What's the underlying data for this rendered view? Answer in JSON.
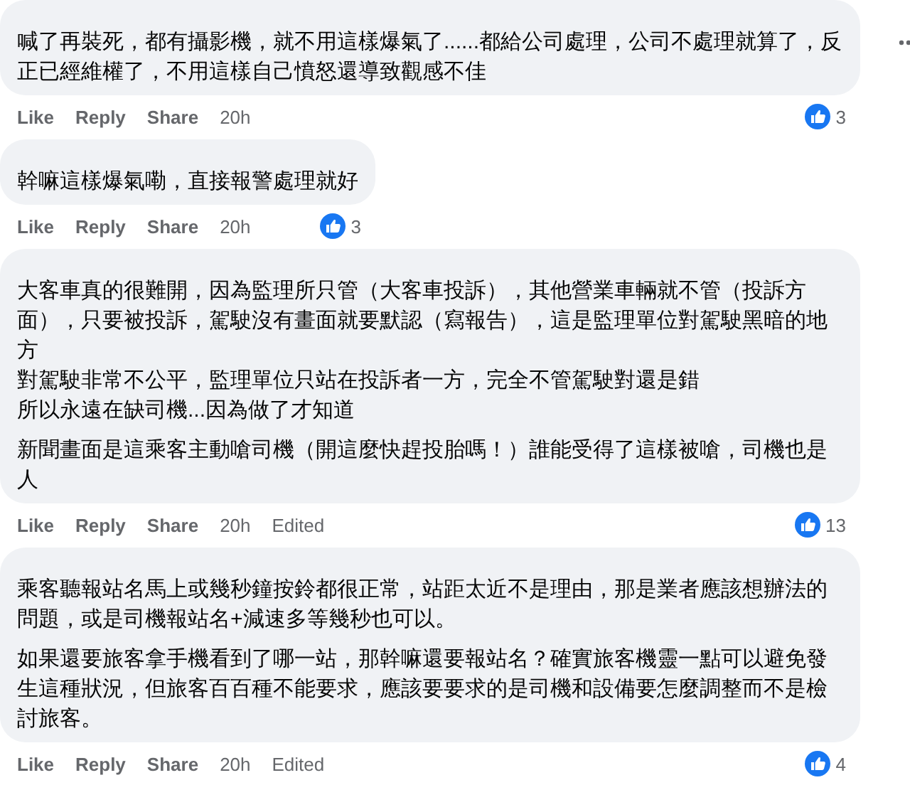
{
  "comments": [
    {
      "paragraphs": [
        "喊了再裝死，都有攝影機，就不用這樣爆氣了......都給公司處理，公司不處理就算了，反正已經維權了，不用這樣自己憤怒還導致觀感不佳"
      ],
      "actions": [
        "Like",
        "Reply",
        "Share"
      ],
      "time": "20h",
      "reactions": "3"
    },
    {
      "paragraphs": [
        "幹嘛這樣爆氣嘞，直接報警處理就好"
      ],
      "actions": [
        "Like",
        "Reply",
        "Share"
      ],
      "time": "20h",
      "reactions": "3"
    },
    {
      "paragraphs": [
        [
          "大客車真的很難開，因為監理所只管（大客車投訴），其他營業車輛就不管（投訴方面），只要被投訴，駕駛沒有畫面就要默認（寫報告），這是監理單位對駕駛黑暗的地方",
          "對駕駛非常不公平，監理單位只站在投訴者一方，完全不管駕駛對還是錯",
          "所以永遠在缺司機...因為做了才知道"
        ],
        [
          "新聞畫面是這乘客主動嗆司機（開這麼快趕投胎嗎！）誰能受得了這樣被嗆，司機也是人"
        ]
      ],
      "actions": [
        "Like",
        "Reply",
        "Share"
      ],
      "time": "20h",
      "edited": "Edited",
      "reactions": "13"
    },
    {
      "paragraphs": [
        "乘客聽報站名馬上或幾秒鐘按鈴都很正常，站距太近不是理由，那是業者應該想辦法的問題，或是司機報站名+減速多等幾秒也可以。",
        "如果還要旅客拿手機看到了哪一站，那幹嘛還要報站名？確實旅客機靈一點可以避免發生這種狀況，但旅客百百種不能要求，應該要要求的是司機和設備要怎麼調整而不是檢討旅客。"
      ],
      "actions": [
        "Like",
        "Reply",
        "Share"
      ],
      "time": "20h",
      "edited": "Edited",
      "reactions": "4"
    }
  ]
}
